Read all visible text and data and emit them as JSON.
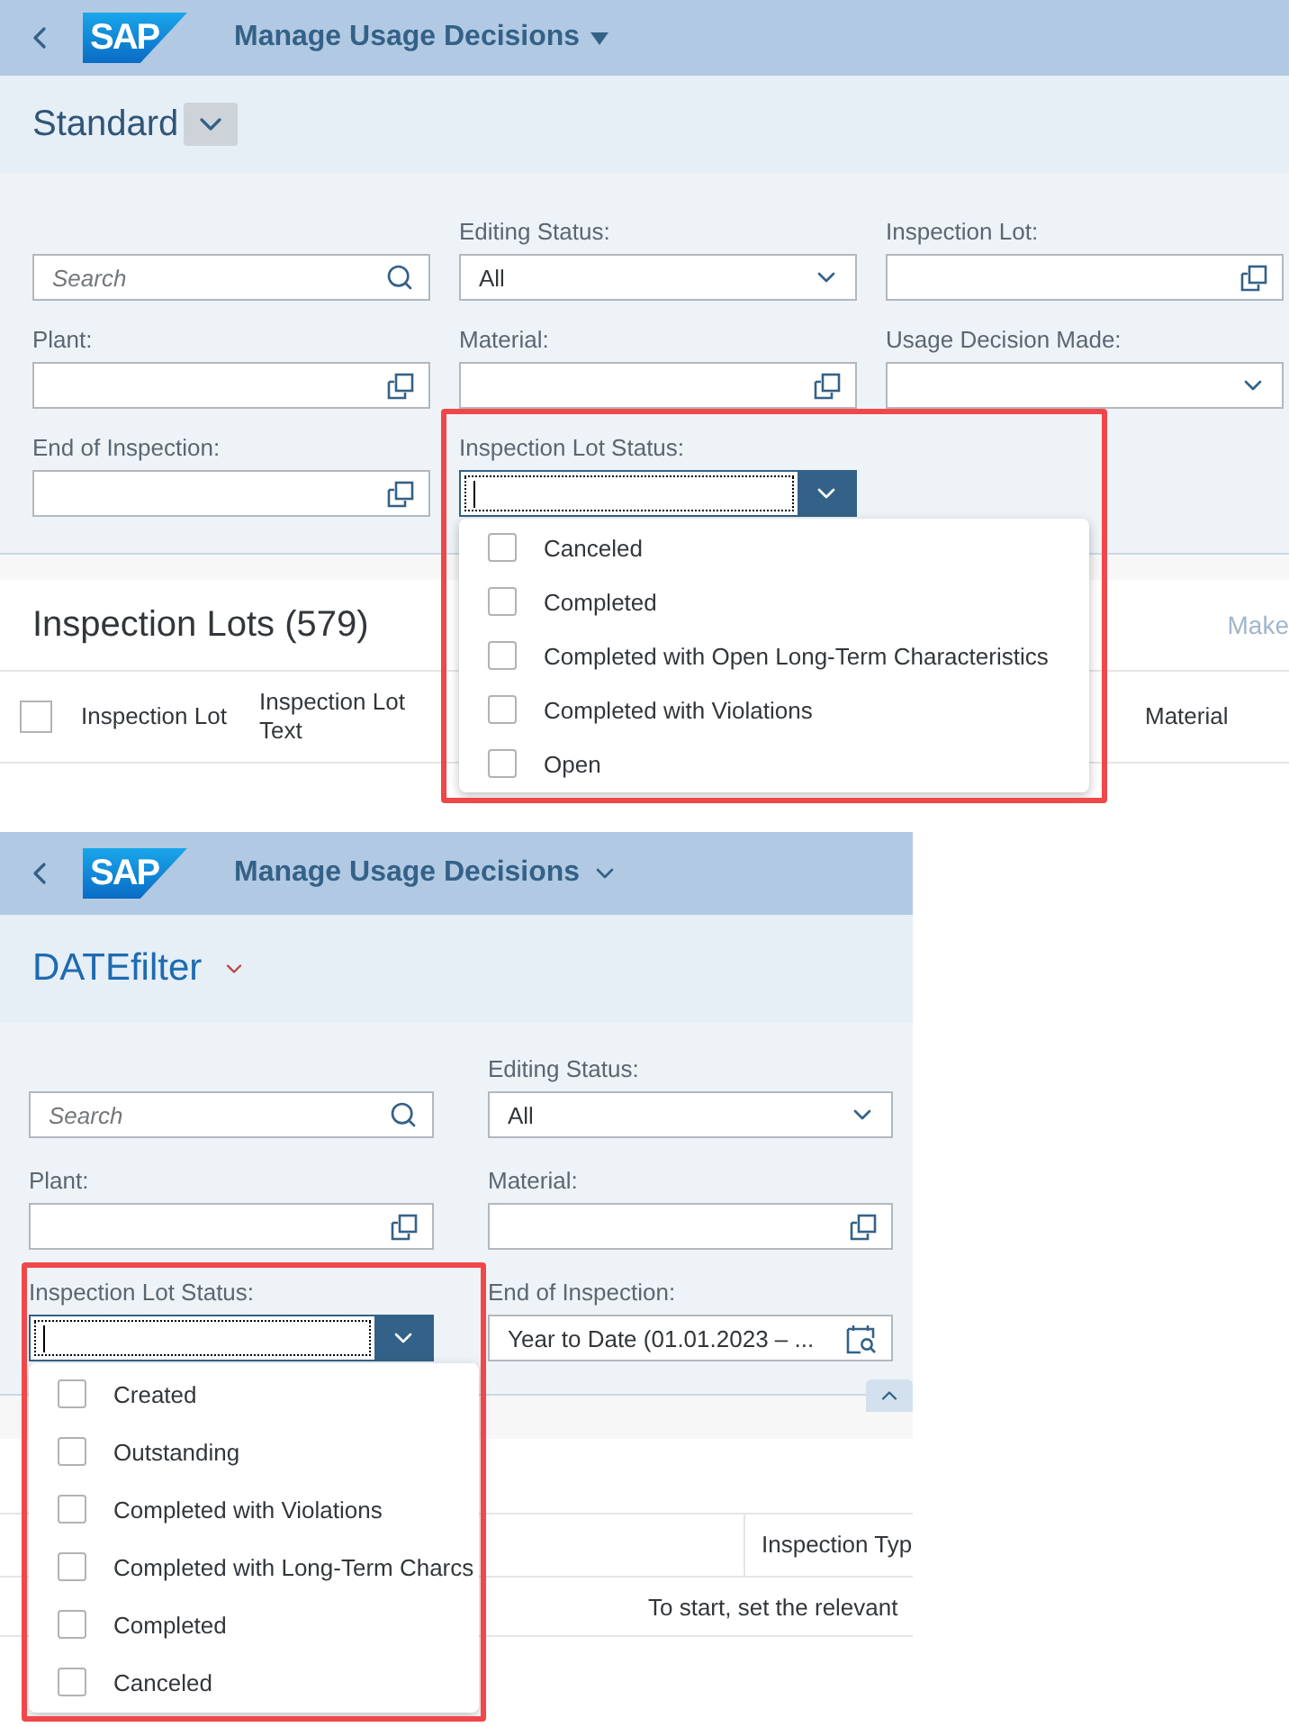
{
  "screens": [
    {
      "header": {
        "logo": "SAP",
        "title": "Manage Usage Decisions"
      },
      "variant": {
        "name": "Standard"
      },
      "filters": [
        {
          "kind": "search",
          "placeholder": "Search"
        },
        {
          "kind": "select",
          "label": "Editing Status:",
          "value": "All"
        },
        {
          "kind": "value-help",
          "label": "Inspection Lot:"
        },
        {
          "kind": "value-help",
          "label": "Plant:"
        },
        {
          "kind": "value-help",
          "label": "Material:"
        },
        {
          "kind": "select",
          "label": "Usage Decision Made:"
        },
        {
          "kind": "value-help",
          "label": "End of Inspection:"
        },
        {
          "kind": "multi-combo",
          "label": "Inspection Lot Status:",
          "expanded": true,
          "options": [
            {
              "label": "Canceled",
              "checked": false
            },
            {
              "label": "Completed",
              "checked": false
            },
            {
              "label": "Completed with Open Long-Term Characteristics",
              "checked": false
            },
            {
              "label": "Completed with Violations",
              "checked": false
            },
            {
              "label": "Open",
              "checked": false
            }
          ]
        }
      ],
      "table": {
        "title": "Inspection Lots (579)",
        "action": "Make",
        "select_all_checked": false,
        "columns": [
          "Inspection Lot",
          "Inspection Lot Text",
          "Material"
        ]
      }
    },
    {
      "header": {
        "logo": "SAP",
        "title": "Manage Usage Decisions"
      },
      "variant": {
        "name": "DATEfilter"
      },
      "filters": [
        {
          "kind": "search",
          "placeholder": "Search"
        },
        {
          "kind": "select",
          "label": "Editing Status:",
          "value": "All"
        },
        {
          "kind": "value-help",
          "label": "Plant:"
        },
        {
          "kind": "value-help",
          "label": "Material:"
        },
        {
          "kind": "multi-combo",
          "label": "Inspection Lot Status:",
          "expanded": true,
          "options": [
            {
              "label": "Created",
              "checked": false
            },
            {
              "label": "Outstanding",
              "checked": false
            },
            {
              "label": "Completed with Violations",
              "checked": false
            },
            {
              "label": "Completed with Long-Term Charcs",
              "checked": false
            },
            {
              "label": "Completed",
              "checked": false
            },
            {
              "label": "Canceled",
              "checked": false
            }
          ]
        },
        {
          "kind": "date",
          "label": "End of Inspection:",
          "value": "Year to Date (01.01.2023 – ..."
        }
      ],
      "table": {
        "columns": [
          "Inspection Typ"
        ],
        "message": "To start, set the relevant"
      }
    }
  ]
}
